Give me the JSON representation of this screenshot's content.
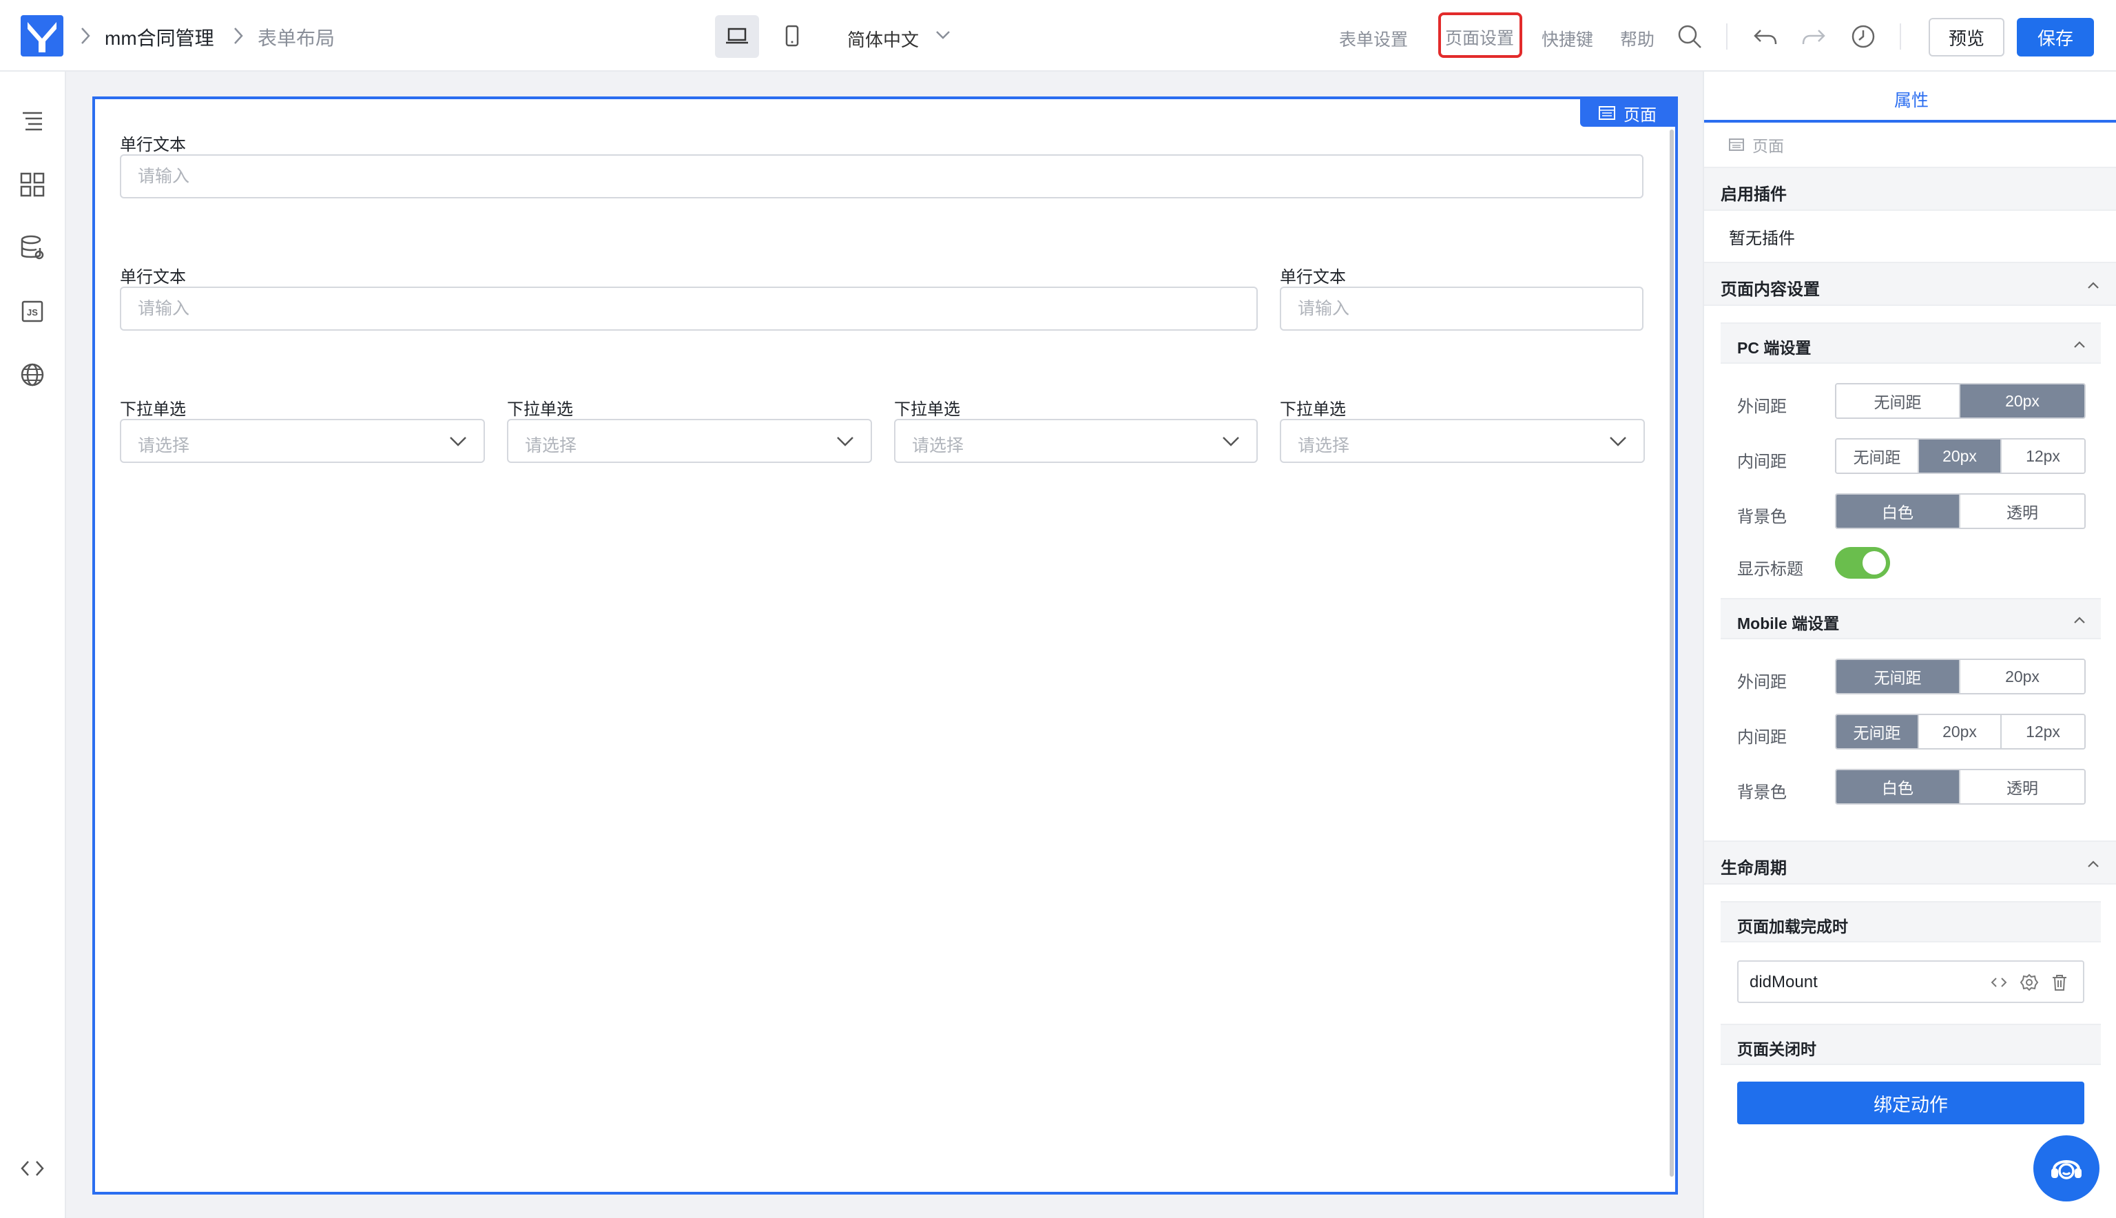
{
  "header": {
    "app_name": "mm合同管理",
    "page_name": "表单布局",
    "language": "简体中文",
    "nav": {
      "form_settings": "表单设置",
      "page_settings": "页面设置",
      "shortcuts": "快捷键",
      "help": "帮助"
    },
    "preview": "预览",
    "save": "保存",
    "accent_color": "#1f6fed",
    "highlight_color": "#e22b2b"
  },
  "sidebar": {
    "icons": [
      "outline-tree-icon",
      "components-grid-icon",
      "datasource-icon",
      "js-code-icon",
      "globe-icon",
      "source-code-icon"
    ]
  },
  "canvas": {
    "tag": "页面",
    "row1": {
      "label": "单行文本",
      "placeholder": "请输入"
    },
    "row2": [
      {
        "label": "单行文本",
        "placeholder": "请输入"
      },
      {
        "label": "单行文本",
        "placeholder": "请输入"
      }
    ],
    "row3": [
      {
        "label": "下拉单选",
        "placeholder": "请选择"
      },
      {
        "label": "下拉单选",
        "placeholder": "请选择"
      },
      {
        "label": "下拉单选",
        "placeholder": "请选择"
      },
      {
        "label": "下拉单选",
        "placeholder": "请选择"
      }
    ]
  },
  "panel": {
    "tab": "属性",
    "crumb": "页面",
    "plugins": {
      "title": "启用插件",
      "empty": "暂无插件"
    },
    "content": {
      "title": "页面内容设置",
      "pc": {
        "title": "PC 端设置",
        "margin": {
          "label": "外间距",
          "options": [
            "无间距",
            "20px"
          ],
          "selected": "20px"
        },
        "padding": {
          "label": "内间距",
          "options": [
            "无间距",
            "20px",
            "12px"
          ],
          "selected": "20px"
        },
        "bg": {
          "label": "背景色",
          "options": [
            "白色",
            "透明"
          ],
          "selected": "白色"
        },
        "show_title": {
          "label": "显示标题",
          "on": true
        }
      },
      "mobile": {
        "title": "Mobile 端设置",
        "margin": {
          "label": "外间距",
          "options": [
            "无间距",
            "20px"
          ],
          "selected": "无间距"
        },
        "padding": {
          "label": "内间距",
          "options": [
            "无间距",
            "20px",
            "12px"
          ],
          "selected": "无间距"
        },
        "bg": {
          "label": "背景色",
          "options": [
            "白色",
            "透明"
          ],
          "selected": "白色"
        }
      }
    },
    "lifecycle": {
      "title": "生命周期",
      "on_load": "页面加载完成时",
      "handler": "didMount",
      "on_close": "页面关闭时",
      "bind_action": "绑定动作"
    }
  }
}
